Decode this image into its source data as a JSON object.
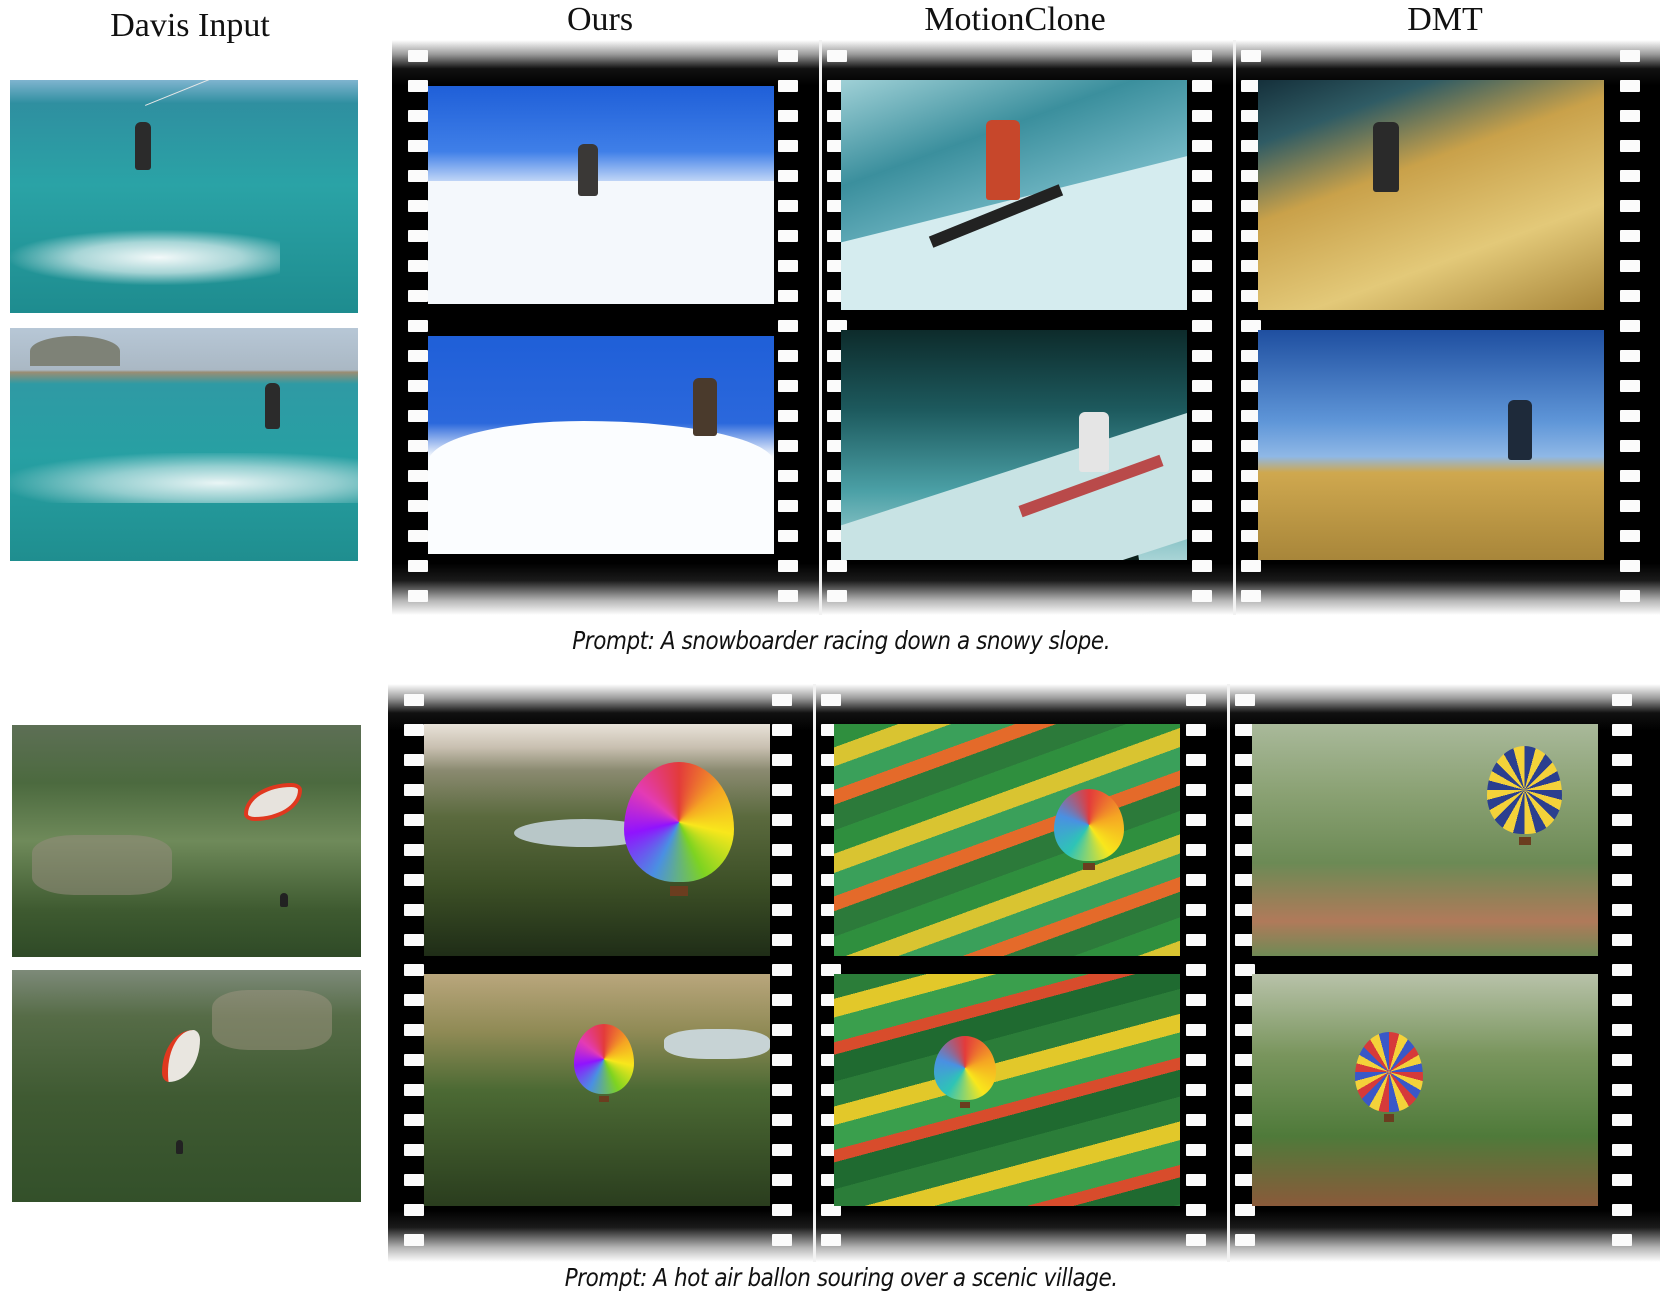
{
  "headers": {
    "input": "Davis Input",
    "ours": "Ours",
    "motionclone": "MotionClone",
    "dmt": "DMT"
  },
  "prompts": {
    "row1": "Prompt: A snowboarder racing down a snowy slope.",
    "row2": "Prompt: A hot air ballon souring over a scenic village."
  },
  "colors": {
    "sea": "#2e9a9c",
    "snow": "#eef4fa",
    "sky": "#1f5fd8",
    "sand": "#c9a14a",
    "valley": "#3f5a32"
  }
}
